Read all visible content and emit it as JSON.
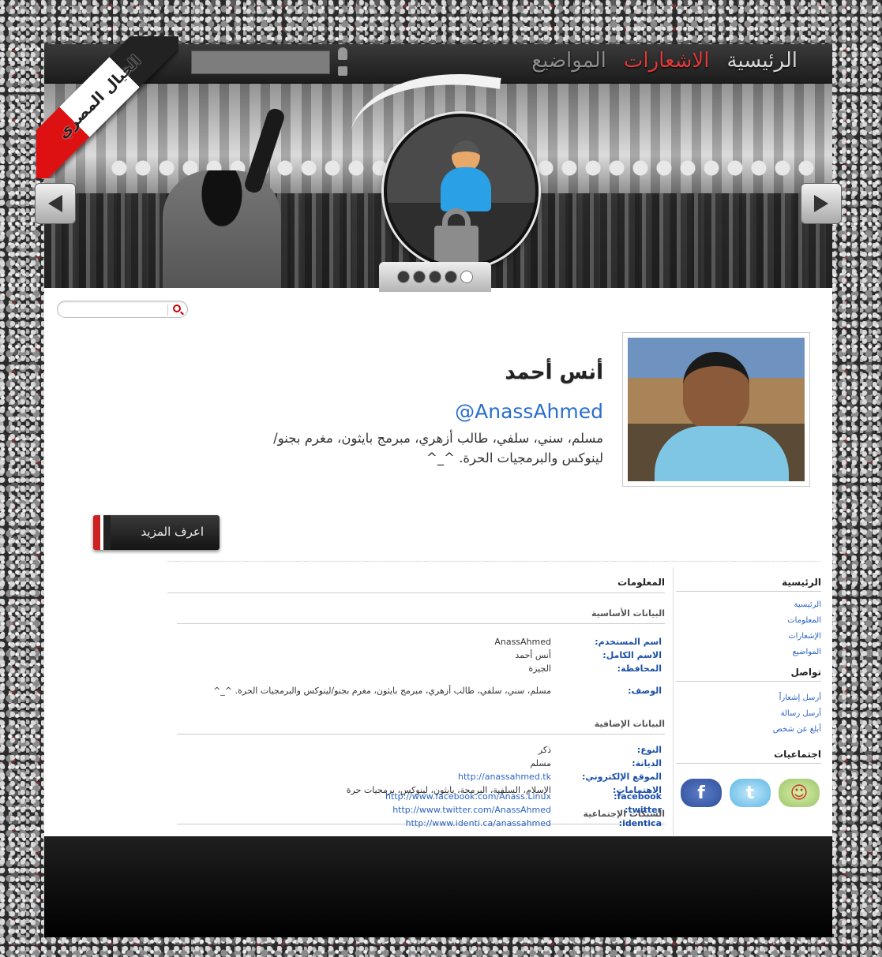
{
  "ribbon": {
    "text": "الخيال المصري"
  },
  "nav": {
    "items": [
      "الرئيسية",
      "الاشعارات",
      "المواضيع"
    ]
  },
  "profile": {
    "name": "أنس أحمد",
    "handle": "@AnassAhmed",
    "bio": "مسلم، سني، سلفي، طالب أزهري، مبرمج بايثون، مغرم بجنو/لينوكس والبرمجيات الحرة. ^_^",
    "more_button": "اعرف المزيد"
  },
  "info": {
    "title": "المعلومات",
    "basic": {
      "title": "البيانات الأساسية",
      "rows": [
        {
          "key": "اسم المستخدم:",
          "value": "AnassAhmed"
        },
        {
          "key": "الاسم الكامل:",
          "value": "أنس أحمد"
        },
        {
          "key": "المحافظة:",
          "value": "الجيزة"
        },
        {
          "key": "الوصف:",
          "value": "مسلم، سني، سلفي، طالب أزهري، مبرمج بايثون، مغرم بجنو/لينوكس والبرمجيات الحرة. ^_^"
        }
      ]
    },
    "extra": {
      "title": "البيانات الإضافية",
      "rows": [
        {
          "key": "النوع:",
          "value": "ذكر"
        },
        {
          "key": "الديانة:",
          "value": "مسلم"
        },
        {
          "key": "الموقع الإلكتروني:",
          "value": "http://anassahmed.tk"
        },
        {
          "key": "الاهتمامات:",
          "value": "الإسلام، السلفية، البرمجة، بايثون، لينوكس، برمجيات حرة"
        }
      ]
    },
    "social": {
      "title": "الشبكات الإجتماعية",
      "rows": [
        {
          "key": "facebook:",
          "value": "http://www.facebook.com/Anass.Linux"
        },
        {
          "key": "twitter:",
          "value": "http://www.twitter.com/AnassAhmed"
        },
        {
          "key": "identica:",
          "value": "http://www.identi.ca/anassahmed"
        }
      ]
    }
  },
  "sidebar": {
    "home": {
      "title": "الرئيسية",
      "links": [
        "الرئيسية",
        "المعلومات",
        "الإشعارات",
        "المواضيع"
      ]
    },
    "contact": {
      "title": "تواصل",
      "links": [
        "أرسل إشعاراً",
        "أرسل رسالة",
        "أبلغ عن شخص"
      ]
    },
    "social": {
      "title": "اجتماعيات",
      "icons": [
        "identica-icon",
        "twitter-icon",
        "facebook-icon"
      ]
    }
  },
  "colors": {
    "accent": "#e03a3a",
    "link": "#2a62c6",
    "label": "#1a4fa8"
  }
}
